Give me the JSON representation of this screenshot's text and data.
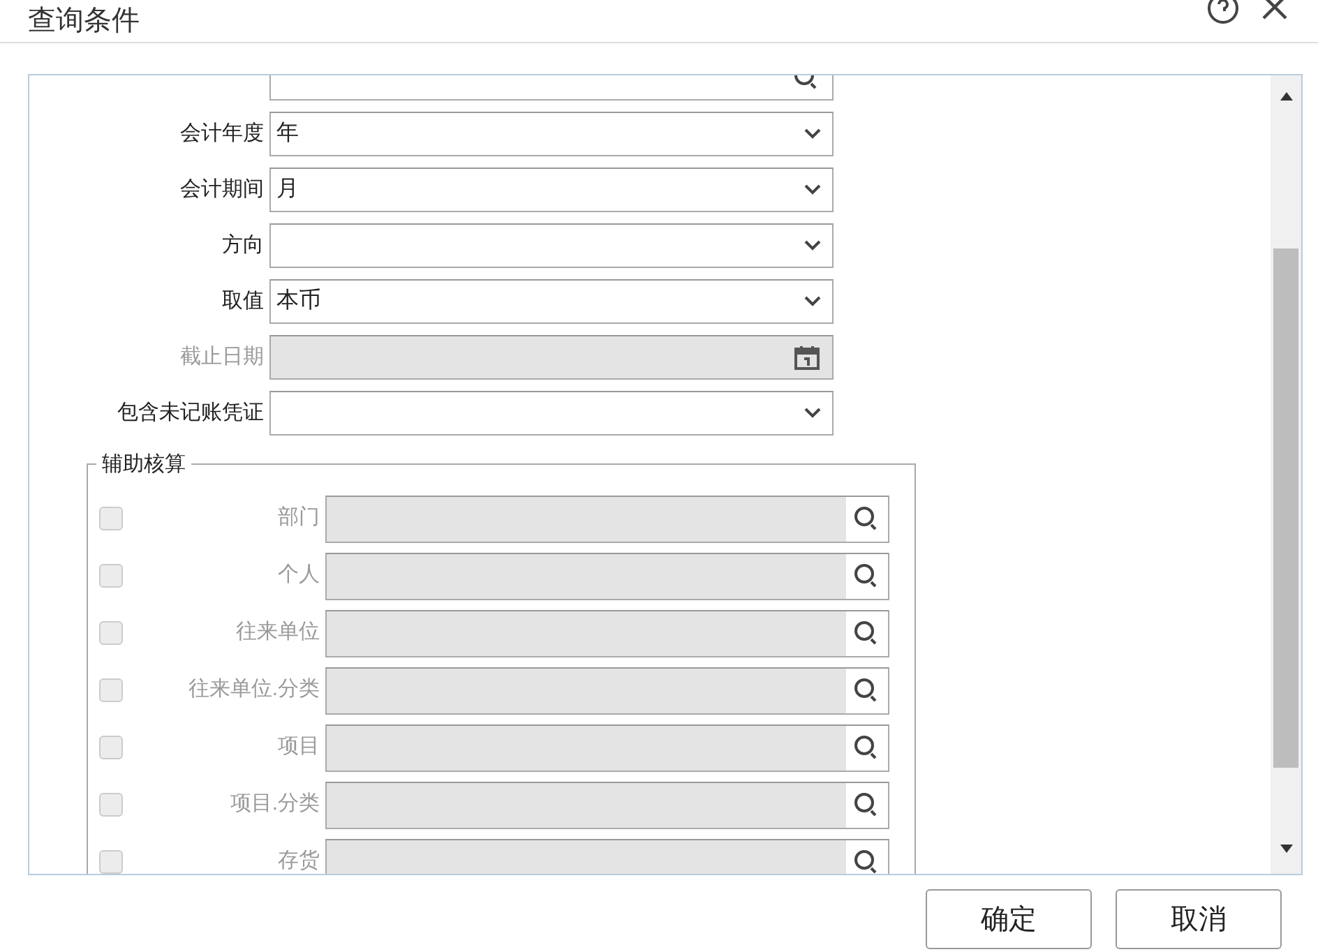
{
  "window": {
    "title": "查询条件"
  },
  "fields": [
    {
      "kind": "lookup",
      "disabled": false
    },
    {
      "kind": "select",
      "label": "会计年度",
      "value": "年",
      "disabled": false
    },
    {
      "kind": "select",
      "label": "会计期间",
      "value": "月",
      "disabled": false
    },
    {
      "kind": "select",
      "label": "方向",
      "disabled": false
    },
    {
      "kind": "select",
      "label": "取值",
      "value": "本币",
      "disabled": false
    },
    {
      "kind": "date",
      "label": "截止日期",
      "disabled": true
    },
    {
      "kind": "select",
      "label": "包含未记账凭证",
      "disabled": false
    }
  ],
  "aux_group": {
    "title": "辅助核算",
    "items": [
      {
        "label": "部门",
        "checked": false,
        "disabled": true
      },
      {
        "label": "个人",
        "checked": false,
        "disabled": true
      },
      {
        "label": "往来单位",
        "checked": false,
        "disabled": true
      },
      {
        "label": "往来单位.分类",
        "checked": false,
        "disabled": true
      },
      {
        "label": "项目",
        "checked": false,
        "disabled": true
      },
      {
        "label": "项目.分类",
        "checked": false,
        "disabled": true
      },
      {
        "label": "存货",
        "checked": false,
        "disabled": true
      }
    ]
  },
  "buttons": [
    "确定",
    "取消"
  ]
}
